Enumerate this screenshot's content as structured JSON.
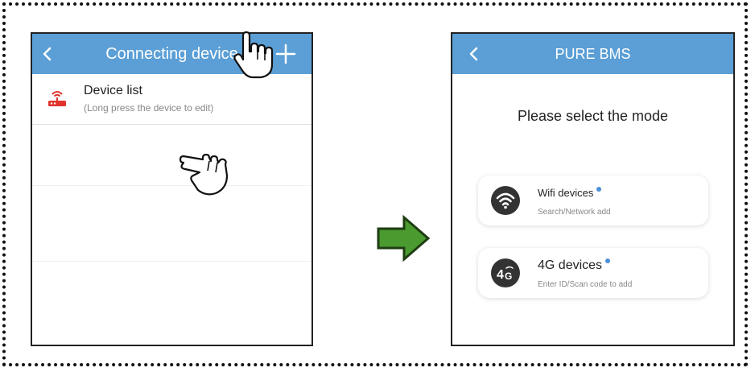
{
  "left_screen": {
    "title": "Connecting device",
    "device_list": {
      "title": "Device list",
      "subtitle": "(Long press the device to edit)"
    }
  },
  "right_screen": {
    "title": "PURE BMS",
    "prompt": "Please select the mode",
    "modes": [
      {
        "label": "Wifi devices",
        "sub": "Search/Network add",
        "icon": "wifi-icon"
      },
      {
        "label": "4G devices",
        "sub": "Enter ID/Scan code to add",
        "icon": "4g-icon"
      }
    ]
  },
  "colors": {
    "app_bar": "#5b9fd6",
    "arrow_fill": "#4a9a2f",
    "router_icon": "#e0342c",
    "status_dot": "#4a90d9"
  }
}
